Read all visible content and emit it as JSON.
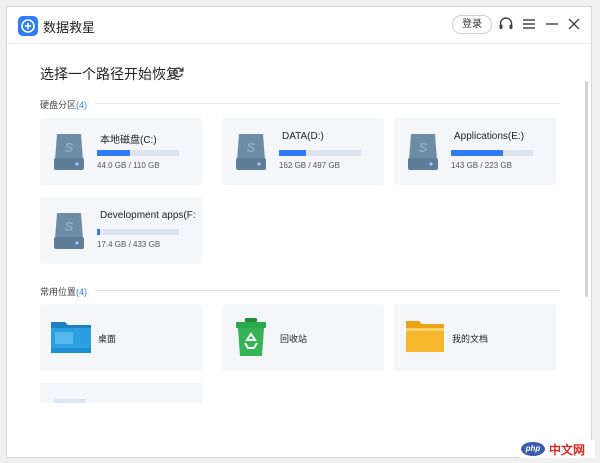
{
  "app": {
    "title": "数据救星",
    "login_label": "登录"
  },
  "main": {
    "path_title": "选择一个路径开始恢复",
    "drives_section": {
      "label": "硬盘分区",
      "count": "(4)"
    },
    "drives": [
      {
        "name": "本地磁盘(C:)",
        "size": "44.0 GB / 110 GB",
        "used_fraction": 0.4
      },
      {
        "name": "DATA(D:)",
        "size": "162 GB / 497 GB",
        "used_fraction": 0.33
      },
      {
        "name": "Applications(E:)",
        "size": "143 GB / 223 GB",
        "used_fraction": 0.64
      },
      {
        "name": "Development apps(F:",
        "size": "17.4 GB / 433 GB",
        "used_fraction": 0.04
      }
    ],
    "locations_section": {
      "label": "常用位置",
      "count": "(4)"
    },
    "locations": [
      {
        "name": "桌面",
        "icon": "desktop-folder-icon"
      },
      {
        "name": "回收站",
        "icon": "recycle-bin-icon"
      },
      {
        "name": "我的文档",
        "icon": "documents-folder-icon"
      }
    ]
  },
  "watermark": {
    "logo_text": "php",
    "text": "中文网"
  },
  "colors": {
    "accent": "#2f7cf6",
    "card_bg": "#f5f6f9",
    "drive_icon": "#5f7d97",
    "folder_yellow": "#f5b72c",
    "bin_green": "#2aa84a"
  }
}
